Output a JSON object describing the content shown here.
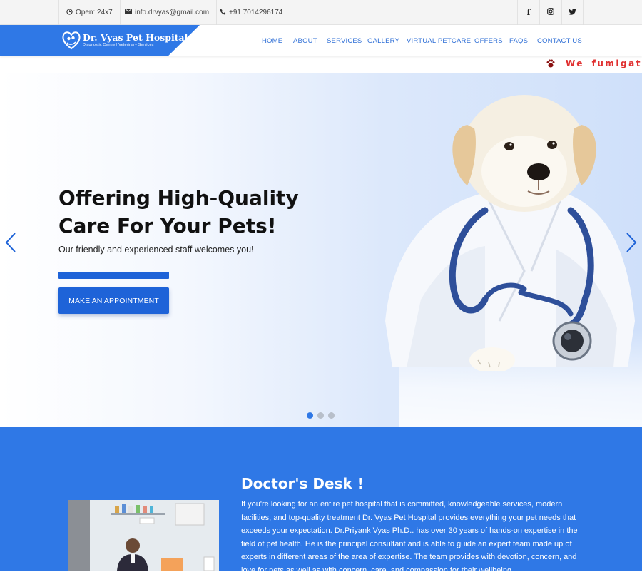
{
  "topbar": {
    "hours": "Open: 24x7",
    "email": "info.drvyas@gmail.com",
    "phone": "+91 7014296174",
    "social_icons": [
      "facebook-icon",
      "instagram-icon",
      "twitter-icon"
    ]
  },
  "brand": {
    "name": "Dr. Vyas Pet Hospital",
    "tagline": "Diagnostic Centre | Veterinary Services",
    "color": "#2f78e6"
  },
  "nav": {
    "items": [
      "HOME",
      "ABOUT",
      "SERVICES",
      "GALLERY",
      "VIRTUAL PETCARE",
      "OFFERS",
      "FAQS",
      "CONTACT US"
    ]
  },
  "marquee": {
    "text": "We fumigate &"
  },
  "hero": {
    "title_line1": "Offering High-Quality",
    "title_line2": "Care For Your Pets!",
    "subtitle": "Our friendly and experienced staff welcomes you!",
    "cta": "MAKE AN APPOINTMENT",
    "slides": 3,
    "active_slide": 1
  },
  "doctor": {
    "title": "Doctor's Desk !",
    "text": "If you're looking for an entire pet hospital that is committed, knowledgeable services, modern facilities, and top-quality treatment Dr. Vyas Pet Hospital provides everything your pet needs that exceeds your expectation. Dr.Priyank Vyas Ph.D.. has over 30 years of hands-on expertise in the field of pet health. He is the principal consultant and is able to guide an expert team made up of experts in different areas of the area of expertise. The team provides with devotion, concern, and love for pets as well as with concern, care, and compassion for their wellbeing."
  }
}
